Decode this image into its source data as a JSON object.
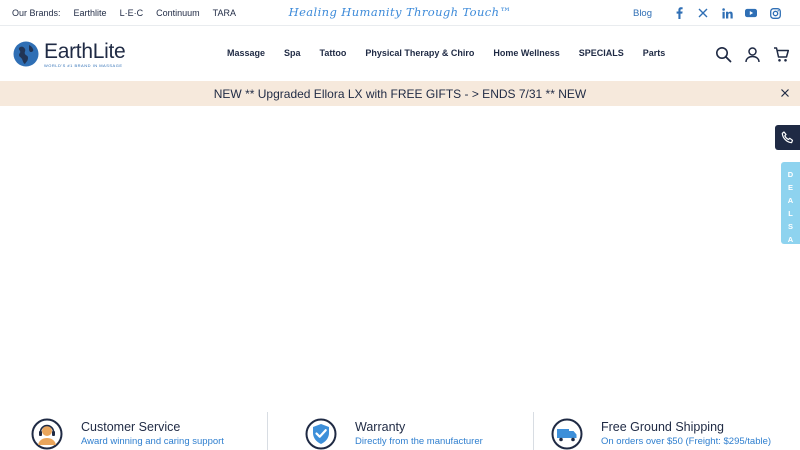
{
  "topbar": {
    "brands": [
      "Our Brands:",
      "Earthlite",
      "L·E·C",
      "Continuum",
      "TARA"
    ],
    "tagline": "Healing Humanity Through Touch™",
    "blog": "Blog",
    "social_icons": [
      "facebook-icon",
      "x-twitter-icon",
      "linkedin-icon",
      "youtube-icon",
      "instagram-icon"
    ]
  },
  "header": {
    "logo_name": "EarthLite",
    "logo_sub": "WORLD'S #1 BRAND IN MASSAGE",
    "nav": [
      "Massage",
      "Spa",
      "Tattoo",
      "Physical Therapy & Chiro",
      "Home Wellness",
      "SPECIALS",
      "Parts"
    ],
    "icons": [
      "search-icon",
      "account-icon",
      "cart-icon"
    ]
  },
  "promo": {
    "text": "NEW ** Upgraded Ellora LX with FREE GIFTS - > ENDS 7/31 ** NEW"
  },
  "side": {
    "deals_label": "DEALS A"
  },
  "features": [
    {
      "title": "Customer Service",
      "subtitle": "Award winning and caring support",
      "icon": "headset-icon"
    },
    {
      "title": "Warranty",
      "subtitle": "Directly from the manufacturer",
      "icon": "shield-check-icon"
    },
    {
      "title": "Free Ground Shipping",
      "subtitle": "On orders over $50 (Freight: $295/table)",
      "icon": "truck-icon"
    }
  ],
  "colors": {
    "navy": "#1f2a44",
    "accent_blue": "#2f7fcf",
    "promo_bg": "#f6e9dc",
    "deals_tab": "#8ed3ef"
  }
}
